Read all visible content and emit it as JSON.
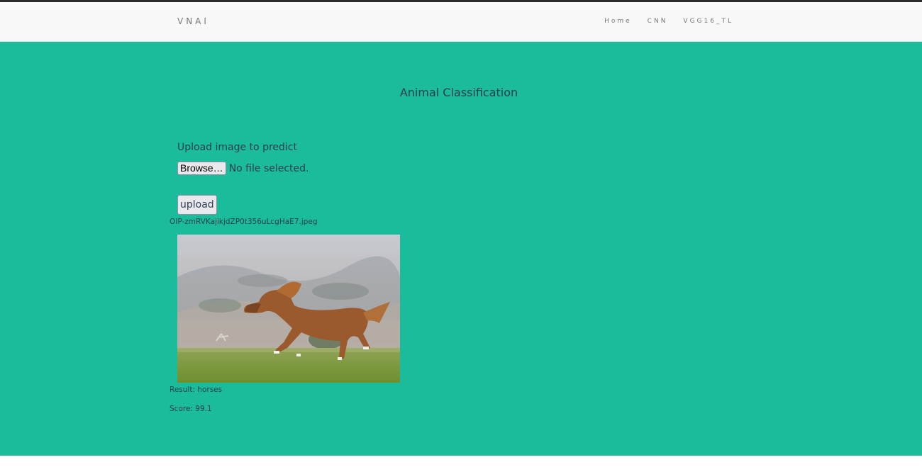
{
  "navbar": {
    "brand": "VNAI",
    "links": [
      "Home",
      "CNN",
      "VGG16_TL"
    ]
  },
  "main": {
    "title": "Animal Classification",
    "upload_label": "Upload image to predict",
    "browse_label": "Browse…",
    "file_status": "No file selected.",
    "upload_button": "upload",
    "file_name": "OIP-zmRVKajikjdZP0t356uLcgHaE7.jpeg",
    "result_text": "Result: horses",
    "score_text": "Score: 99.1"
  },
  "colors": {
    "background": "#1abc9c",
    "navbar": "#f8f8f8",
    "text": "#2c3e50"
  }
}
